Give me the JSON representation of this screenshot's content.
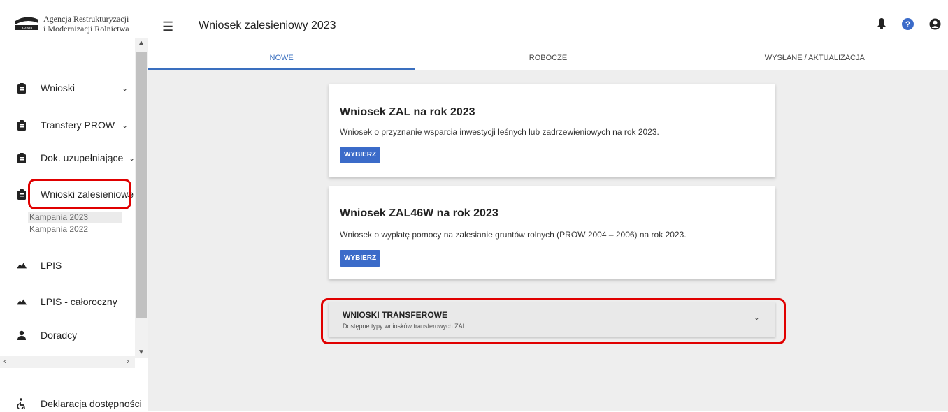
{
  "logo": {
    "line1": "Agencja Restrukturyzacji",
    "line2": "i Modernizacji Rolnictwa",
    "mark": "ARiMR"
  },
  "sidebar": {
    "items": [
      {
        "label": "Wnioski",
        "icon": "clipboard-icon"
      },
      {
        "label": "Transfery PROW",
        "icon": "clipboard-icon"
      },
      {
        "label": "Dok. uzupełniające",
        "icon": "clipboard-icon"
      },
      {
        "label": "Wnioski zalesieniowe",
        "icon": "clipboard-icon"
      },
      {
        "label": "LPIS",
        "icon": "mountain-icon"
      },
      {
        "label": "LPIS - całoroczny",
        "icon": "mountain-icon"
      },
      {
        "label": "Doradcy",
        "icon": "person-icon"
      }
    ],
    "subitems": [
      "Kampania 2023",
      "Kampania 2022"
    ],
    "footer": {
      "label": "Deklaracja dostępności",
      "icon": "accessibility-icon"
    }
  },
  "header": {
    "title": "Wniosek zalesieniowy 2023"
  },
  "tabs": [
    "NOWE",
    "ROBOCZE",
    "WYSŁANE / AKTUALIZACJA"
  ],
  "cards": [
    {
      "title": "Wniosek ZAL na rok 2023",
      "desc": "Wniosek o przyznanie wsparcia inwestycji leśnych lub zadrzewieniowych na rok 2023.",
      "button": "WYBIERZ"
    },
    {
      "title": "Wniosek ZAL46W na rok 2023",
      "desc": "Wniosek o wypłatę pomocy na zalesianie gruntów rolnych (PROW 2004 – 2006) na rok 2023.",
      "button": "WYBIERZ"
    }
  ],
  "accordion": {
    "title": "WNIOSKI TRANSFEROWE",
    "subtitle": "Dostępne typy wniosków transferowych ZAL"
  },
  "colors": {
    "accent": "#3a6fbf",
    "button": "#3b6bc9",
    "highlight": "#e00000"
  }
}
